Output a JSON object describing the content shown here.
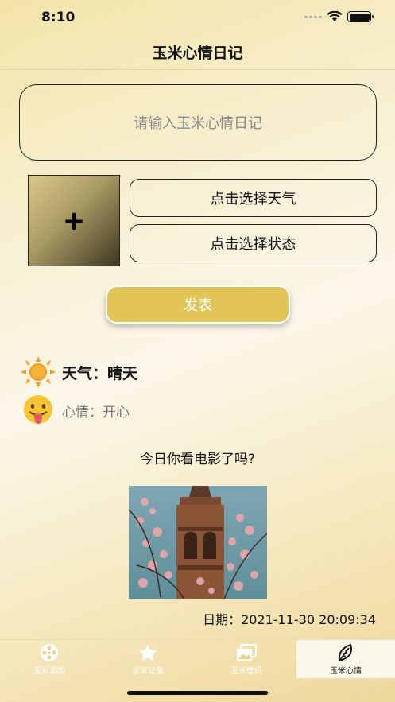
{
  "status_bar": {
    "time": "8:10"
  },
  "nav": {
    "title": "玉米心情日记"
  },
  "form": {
    "diary_placeholder": "请输入玉米心情日记",
    "add_image_symbol": "+",
    "choose_weather_label": "点击选择天气",
    "choose_mood_label": "点击选择状态",
    "publish_label": "发表"
  },
  "entry": {
    "weather_label": "天气：晴天",
    "mood_label": "心情：开心",
    "text": "今日你看电影了吗?",
    "date": "日期：2021-11-30   20:09:34"
  },
  "tabs": [
    {
      "label": "玉米添加",
      "icon": "film-reel-icon"
    },
    {
      "label": "玉米记录",
      "icon": "star-icon"
    },
    {
      "label": "玉米壁纸",
      "icon": "picture-icon"
    },
    {
      "label": "玉米心情",
      "icon": "leaf-icon"
    }
  ],
  "colors": {
    "accent": "#e3c457",
    "background_gold": "#eed79a",
    "active_tab": "#fbf7ea"
  }
}
